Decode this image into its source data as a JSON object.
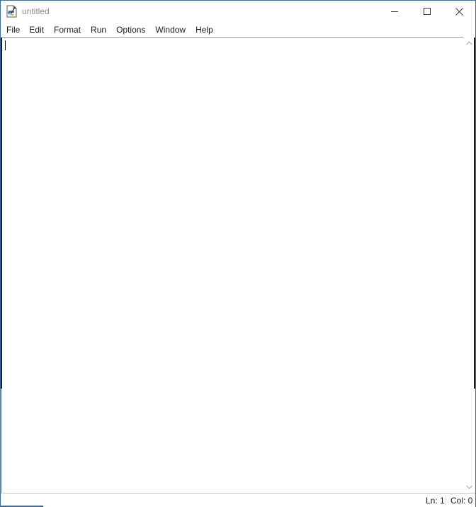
{
  "window": {
    "title": "untitled",
    "app_icon": "python-file-icon"
  },
  "menu": {
    "items": [
      {
        "label": "File"
      },
      {
        "label": "Edit"
      },
      {
        "label": "Format"
      },
      {
        "label": "Run"
      },
      {
        "label": "Options"
      },
      {
        "label": "Window"
      },
      {
        "label": "Help"
      }
    ]
  },
  "editor": {
    "content": ""
  },
  "status": {
    "line": "Ln: 1",
    "column": "Col: 0"
  },
  "colors": {
    "window_border": "#3c6fa3",
    "text": "#1a1a1a",
    "title_inactive": "#8a8a8a"
  }
}
